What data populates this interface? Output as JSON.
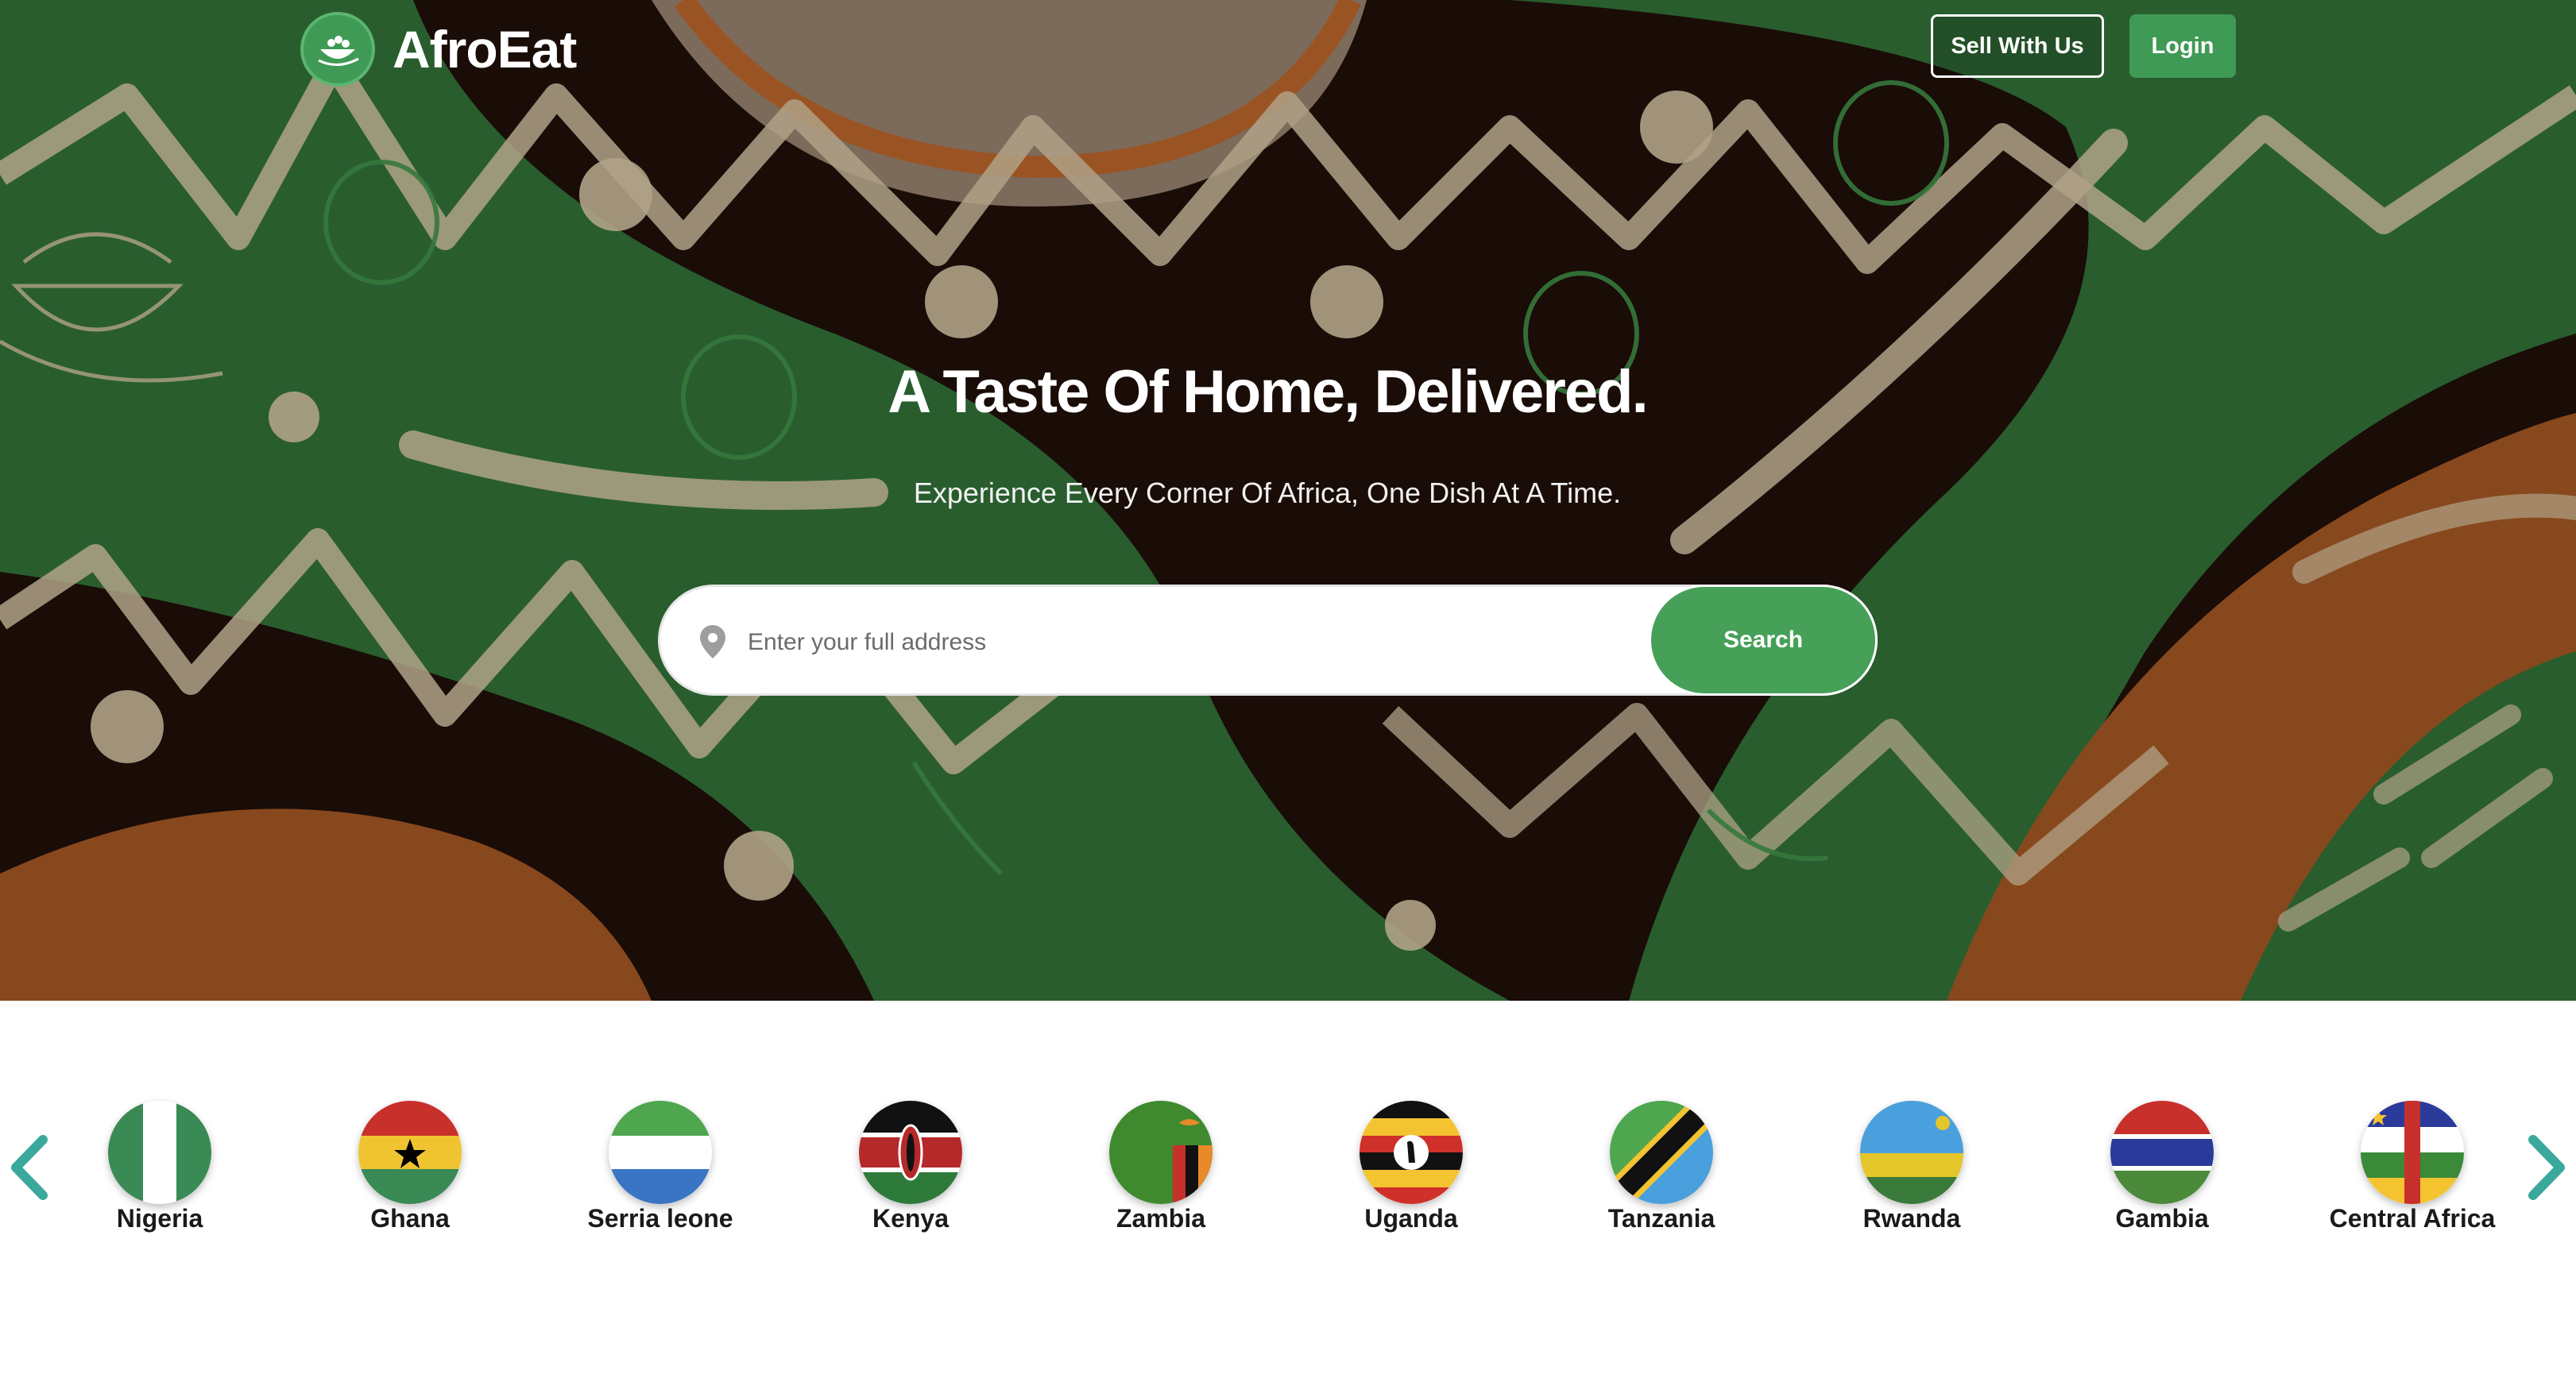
{
  "brand": {
    "name": "AfroEat",
    "green": "#3f9a55"
  },
  "header": {
    "sell_label": "Sell With Us",
    "login_label": "Login"
  },
  "hero": {
    "headline": "A Taste Of Home, Delivered.",
    "subline": "Experience Every Corner Of Africa, One Dish At A Time."
  },
  "search": {
    "placeholder": "Enter your full address",
    "value": "",
    "button_label": "Search"
  },
  "carousel": {
    "prev_icon": "chevron-left-icon",
    "next_icon": "chevron-right-icon",
    "arrow_color": "#3aa89a",
    "countries": [
      {
        "name": "Nigeria",
        "icon": "nigeria-flag-icon"
      },
      {
        "name": "Ghana",
        "icon": "ghana-flag-icon"
      },
      {
        "name": "Serria leone",
        "icon": "sierra-leone-flag-icon"
      },
      {
        "name": "Kenya",
        "icon": "kenya-flag-icon"
      },
      {
        "name": "Zambia",
        "icon": "zambia-flag-icon"
      },
      {
        "name": "Uganda",
        "icon": "uganda-flag-icon"
      },
      {
        "name": "Tanzania",
        "icon": "tanzania-flag-icon"
      },
      {
        "name": "Rwanda",
        "icon": "rwanda-flag-icon"
      },
      {
        "name": "Gambia",
        "icon": "gambia-flag-icon"
      },
      {
        "name": "Central Africa",
        "icon": "central-africa-flag-icon"
      }
    ]
  }
}
